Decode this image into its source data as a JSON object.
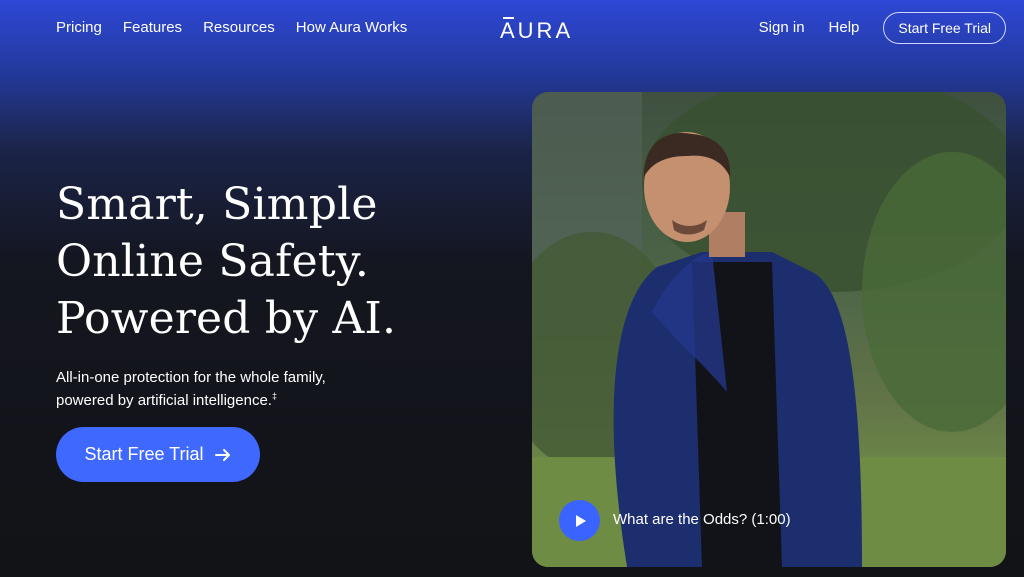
{
  "nav": {
    "left_links": [
      "Pricing",
      "Features",
      "Resources",
      "How Aura Works"
    ],
    "logo": "AURA",
    "right_links": [
      "Sign in",
      "Help"
    ],
    "cta_label": "Start Free Trial"
  },
  "hero": {
    "title_lines": [
      "Smart, Simple",
      "Online Safety.",
      "Powered by AI."
    ],
    "subtitle_lines": [
      "All-in-one protection for the whole family,",
      "powered by artificial intelligence."
    ],
    "subtitle_mark": "‡",
    "cta_label": "Start Free Trial",
    "cta_icon": "arrow-right-icon"
  },
  "video": {
    "caption": "What are the Odds? (1:00)",
    "play_icon": "play-icon"
  },
  "colors": {
    "accent": "#3f68ff",
    "background_top": "#2e47d6",
    "background_bottom": "#121316"
  }
}
